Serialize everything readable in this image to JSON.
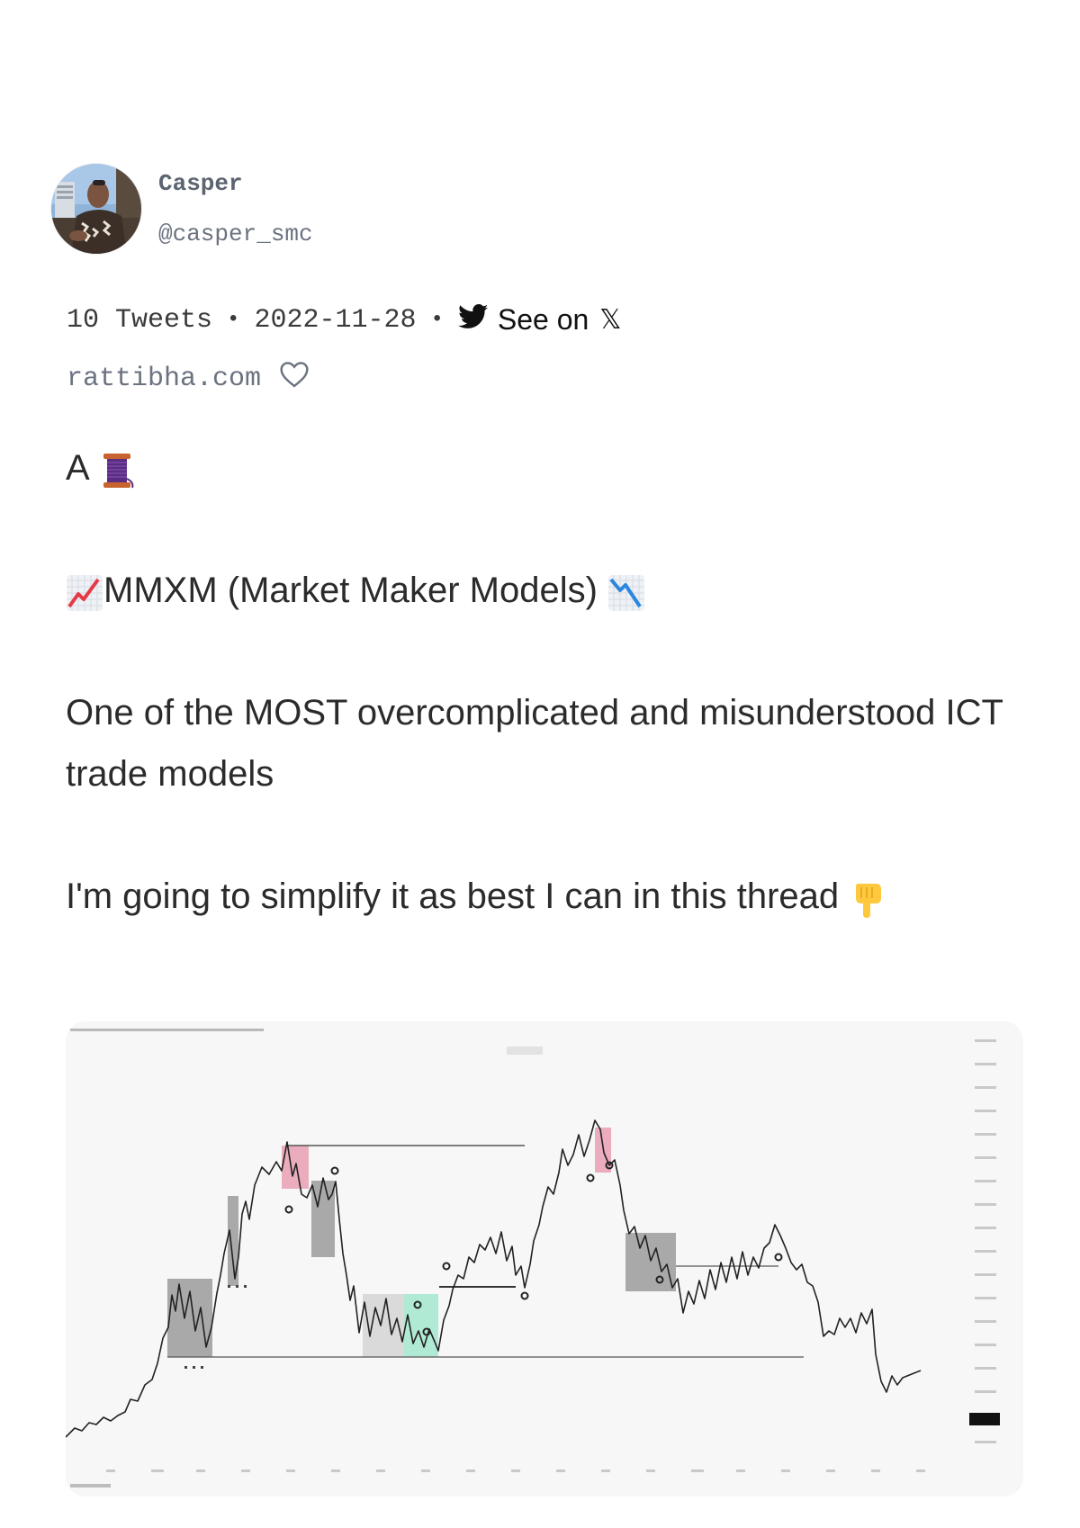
{
  "author": {
    "display_name": "Casper",
    "handle": "@casper_smc"
  },
  "meta": {
    "tweet_count": "10 Tweets",
    "separator": "•",
    "date": "2022-11-28",
    "see_on_label": "See on",
    "x_glyph": "𝕏"
  },
  "source": {
    "site": "rattibha.com"
  },
  "tweet": {
    "line1": "A",
    "line2": "MMXM (Market Maker Models)",
    "line3": "One of the MOST overcomplicated and misunderstood ICT trade models",
    "line4": "I'm going to simplify it as best I can in this thread"
  },
  "icons": {
    "avatar": "profile-photo",
    "bird": "twitter-bird-icon",
    "heart": "heart-outline-icon",
    "spool": "thread-spool-emoji",
    "chart_up": "chart-increasing-emoji",
    "chart_down": "chart-decreasing-emoji",
    "point_down": "backhand-index-pointing-down-emoji"
  },
  "colors": {
    "name": "#5b6470",
    "muted": "#6b7280",
    "body_text": "#2b2b2b",
    "chart_bg": "#f7f7f7",
    "premium_pink": "#e9a4b6",
    "discount_green": "#a9e8cf",
    "consolidation_gray": "#8f8f8f",
    "twitter_bird": "#111111"
  }
}
